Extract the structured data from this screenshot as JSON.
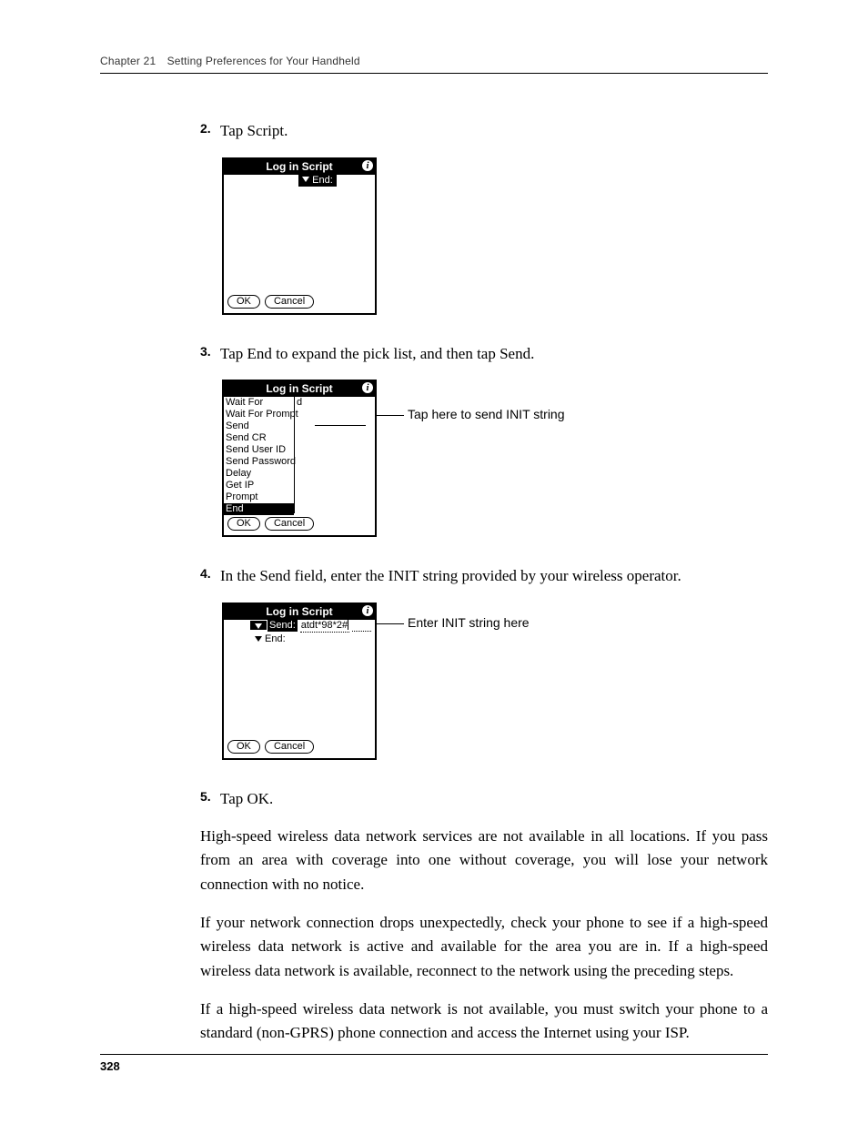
{
  "header": {
    "running": "Chapter 21 Setting Preferences for Your Handheld"
  },
  "steps": {
    "s2": {
      "num": "2.",
      "text": "Tap Script."
    },
    "s3": {
      "num": "3.",
      "text": "Tap End to expand the pick list, and then tap Send."
    },
    "s4": {
      "num": "4.",
      "text": "In the Send field, enter the INIT string provided by your wireless operator."
    },
    "s5": {
      "num": "5.",
      "text": "Tap OK."
    }
  },
  "palm": {
    "title": "Log in Script",
    "info": "i",
    "end_label": "End:",
    "send_label": "Send:",
    "ok": "OK",
    "cancel": "Cancel",
    "init_value": "atdt*98*2#",
    "right_d": "d",
    "menu": [
      "Wait For",
      "Wait For Prompt",
      "Send",
      "Send CR",
      "Send User ID",
      "Send Password",
      "Delay",
      "Get IP",
      "Prompt",
      "End"
    ]
  },
  "callouts": {
    "c1": "Tap here to send INIT string",
    "c2": "Enter INIT string here"
  },
  "paras": {
    "p1": "High-speed wireless data network services are not available in all locations. If you pass from an area with coverage into one without coverage, you will lose your network connection with no notice.",
    "p2": "If your network connection drops unexpectedly, check your phone to see if a high-speed wireless data network is active and available for the area you are in. If a high-speed wireless data network is available, reconnect to the network using the preceding steps.",
    "p3": "If a high-speed wireless data network is not available, you must switch your phone to a standard (non-GPRS) phone connection and access the Internet using your ISP."
  },
  "footer": {
    "page": "328"
  }
}
